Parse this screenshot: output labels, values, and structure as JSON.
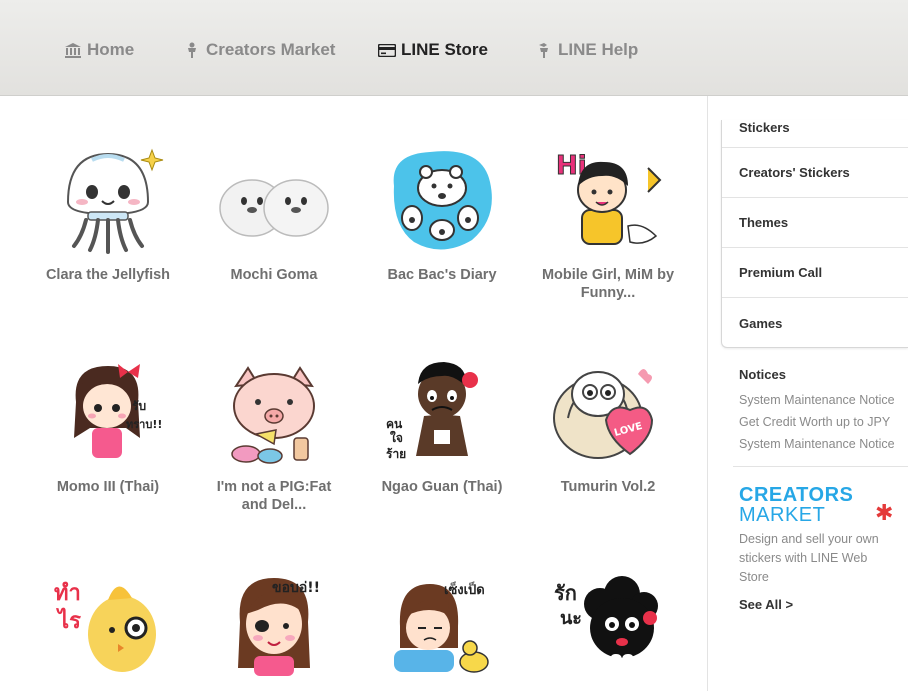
{
  "nav": {
    "home": {
      "label": "Home",
      "icon": "bank-icon"
    },
    "creators_market": {
      "label": "Creators Market",
      "icon": "person-icon"
    },
    "line_store": {
      "label": "LINE Store",
      "icon": "card-icon"
    },
    "line_help": {
      "label": "LINE Help",
      "icon": "help-person-icon"
    }
  },
  "stickers": [
    {
      "title": "Clara the Jellyfish"
    },
    {
      "title": "Mochi Goma"
    },
    {
      "title": "Bac Bac's Diary"
    },
    {
      "title": "Mobile Girl, MiM by Funny..."
    },
    {
      "title": "Momo III (Thai)"
    },
    {
      "title": "I'm not a PIG:Fat and Del..."
    },
    {
      "title": "Ngao Guan (Thai)"
    },
    {
      "title": "Tumurin Vol.2"
    },
    {
      "title": ""
    },
    {
      "title": ""
    },
    {
      "title": ""
    },
    {
      "title": ""
    }
  ],
  "sticker_art": {
    "s1_text": "Hi",
    "s5_text1": "รับ",
    "s5_text2": "ทราบ!!",
    "s7_text1": "คน",
    "s7_text2": "ใจ",
    "s7_text3": "ร้าย",
    "s8_text": "LOVE",
    "s9_text1": "ทำ",
    "s9_text2": "ไร",
    "s10_text": "ขอบอ่!!",
    "s11_text": "เซ็งเป็ด",
    "s12_text1": "รัก",
    "s12_text2": "นะ"
  },
  "sidebar": {
    "menu": [
      "Stickers",
      "Creators' Stickers",
      "Themes",
      "Premium Call",
      "Games"
    ],
    "notices_heading": "Notices",
    "notices": [
      "System Maintenance Notice",
      "Get Credit Worth up to JPY",
      "System Maintenance Notice"
    ],
    "creators_market_line1": "CREATORS",
    "creators_market_line2": "MARKET",
    "creators_market_desc": "Design and sell your own stickers with LINE Web Store",
    "see_all": "See All >"
  },
  "colors": {
    "accent_blue": "#27a7e6",
    "star_red": "#e43a3a"
  }
}
